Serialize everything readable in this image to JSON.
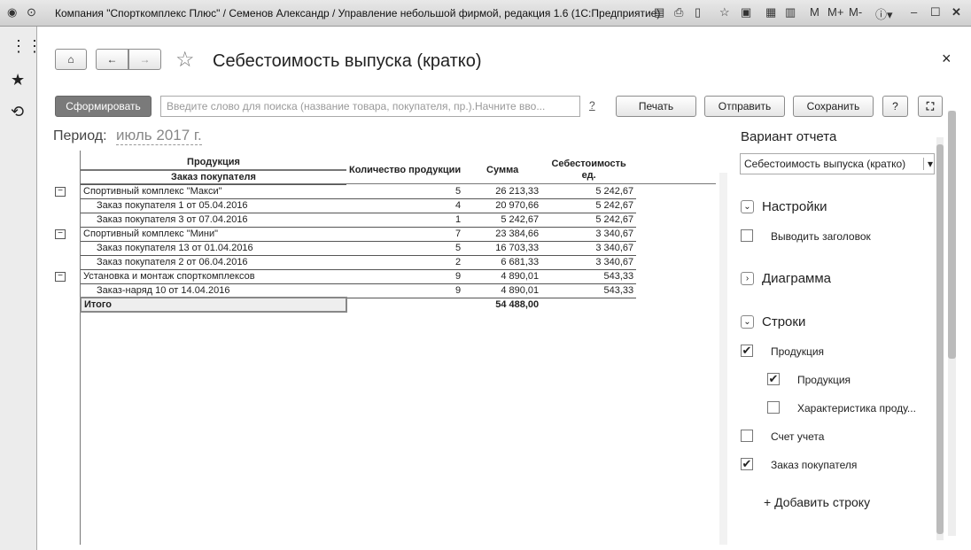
{
  "window": {
    "title": "Компания \"Спорткомплекс Плюс\" / Семенов Александр / Управление небольшой фирмой, редакция 1.6  (1С:Предприятие)",
    "m": "M",
    "mplus": "M+",
    "mminus": "M-"
  },
  "page": {
    "title": "Себестоимость выпуска (кратко)",
    "close": "×"
  },
  "toolbar": {
    "generate": "Сформировать",
    "search_placeholder": "Введите слово для поиска (название товара, покупателя, пр.).Начните вво...",
    "search_help": "?",
    "print": "Печать",
    "send": "Отправить",
    "save": "Сохранить",
    "help": "?"
  },
  "period": {
    "label": "Период:",
    "value": "июль 2017 г."
  },
  "table": {
    "headers": {
      "product": "Продукция",
      "order": "Заказ покупателя",
      "qty": "Количество продукции",
      "sum": "Сумма",
      "cost": "Себестоимость ед."
    },
    "rows": [
      {
        "level": 0,
        "name": "Спортивный комплекс \"Макси\"",
        "qty": "5",
        "sum": "26 213,33",
        "cost": "5 242,67"
      },
      {
        "level": 1,
        "name": "Заказ покупателя 1 от 05.04.2016",
        "qty": "4",
        "sum": "20 970,66",
        "cost": "5 242,67"
      },
      {
        "level": 1,
        "name": "Заказ покупателя 3 от 07.04.2016",
        "qty": "1",
        "sum": "5 242,67",
        "cost": "5 242,67"
      },
      {
        "level": 0,
        "name": "Спортивный комплекс \"Мини\"",
        "qty": "7",
        "sum": "23 384,66",
        "cost": "3 340,67"
      },
      {
        "level": 1,
        "name": "Заказ покупателя 13 от 01.04.2016",
        "qty": "5",
        "sum": "16 703,33",
        "cost": "3 340,67"
      },
      {
        "level": 1,
        "name": "Заказ покупателя 2 от 06.04.2016",
        "qty": "2",
        "sum": "6 681,33",
        "cost": "3 340,67"
      },
      {
        "level": 0,
        "name": "Установка и монтаж спорткомплексов",
        "qty": "9",
        "sum": "4 890,01",
        "cost": "543,33"
      },
      {
        "level": 1,
        "name": "Заказ-наряд 10 от 14.04.2016",
        "qty": "9",
        "sum": "4 890,01",
        "cost": "543,33"
      }
    ],
    "total": {
      "label": "Итого",
      "sum": "54 488,00"
    }
  },
  "panel": {
    "variant_label": "Вариант отчета",
    "variant_value": "Себестоимость выпуска (кратко)",
    "settings": "Настройки",
    "show_header": "Выводить заголовок",
    "diagram": "Диаграмма",
    "rows": "Строки",
    "items": [
      {
        "label": "Продукция",
        "checked": true
      },
      {
        "label": "Продукция",
        "checked": true
      },
      {
        "label": "Характеристика проду...",
        "checked": false
      },
      {
        "label": "Счет учета",
        "checked": false
      },
      {
        "label": "Заказ покупателя",
        "checked": true
      }
    ],
    "add_row": "+ Добавить строку"
  }
}
